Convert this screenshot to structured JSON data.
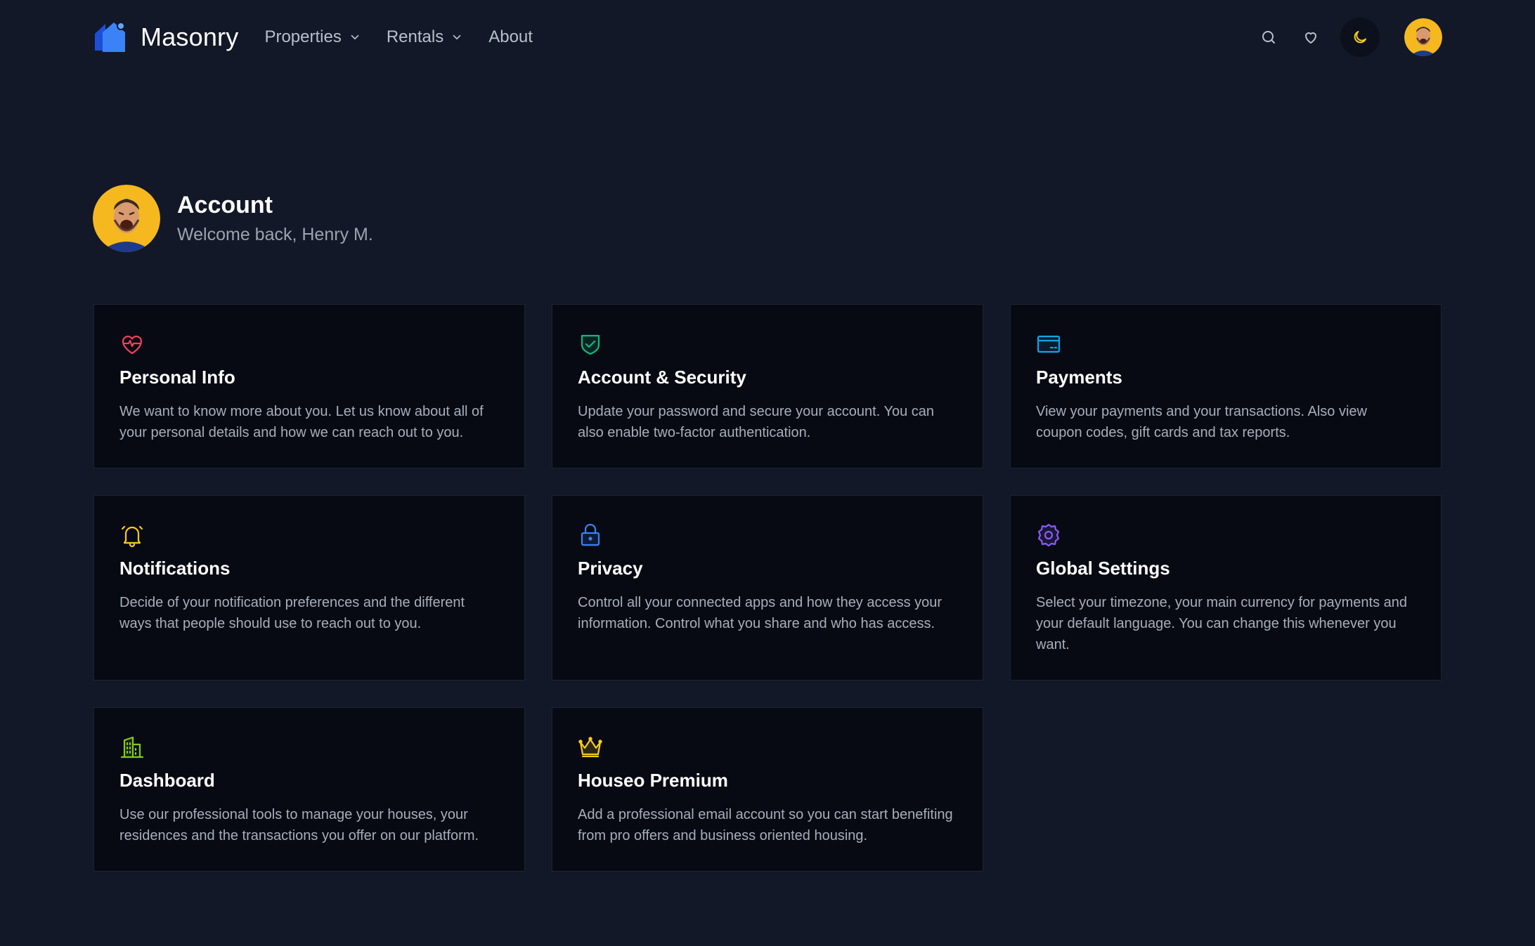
{
  "brand": {
    "name": "Masonry",
    "accent": "#3b82f6"
  },
  "nav": {
    "links": [
      {
        "label": "Properties",
        "has_dropdown": true
      },
      {
        "label": "Rentals",
        "has_dropdown": true
      },
      {
        "label": "About",
        "has_dropdown": false
      }
    ],
    "icons": [
      "search-icon",
      "heart-icon",
      "moon-icon",
      "avatar"
    ],
    "theme_icon_color": "#facc15"
  },
  "account": {
    "title": "Account",
    "subtitle": "Welcome back, Henry M."
  },
  "cards": [
    {
      "title": "Personal Info",
      "desc": "We want to know more about you. Let us know about all of your personal details and how we can reach out to you.",
      "icon": "heart-pulse-icon",
      "color": "#f43f5e"
    },
    {
      "title": "Account & Security",
      "desc": "Update your password and secure your account. You can also enable two-factor authentication.",
      "icon": "shield-check-icon",
      "color": "#10b981"
    },
    {
      "title": "Payments",
      "desc": "View your payments and your transactions. Also view coupon codes, gift cards and tax reports.",
      "icon": "credit-card-icon",
      "color": "#0ea5e9"
    },
    {
      "title": "Notifications",
      "desc": "Decide of your notification preferences and the different ways that people should use to reach out to you.",
      "icon": "bell-icon",
      "color": "#facc15"
    },
    {
      "title": "Privacy",
      "desc": "Control all your connected apps and how they access your information. Control what you share and who has access.",
      "icon": "lock-icon",
      "color": "#3b82f6"
    },
    {
      "title": "Global Settings",
      "desc": "Select your timezone, your main currency for payments and your default language. You can change this whenever you want.",
      "icon": "gear-icon",
      "color": "#8b5cf6"
    },
    {
      "title": "Dashboard",
      "desc": "Use our professional tools to manage your houses, your residences and the transactions you offer on our platform.",
      "icon": "building-icon",
      "color": "#84cc16"
    },
    {
      "title": "Houseo Premium",
      "desc": "Add a professional email account so you can start benefiting from pro offers and business oriented housing.",
      "icon": "crown-icon",
      "color": "#facc15"
    }
  ]
}
